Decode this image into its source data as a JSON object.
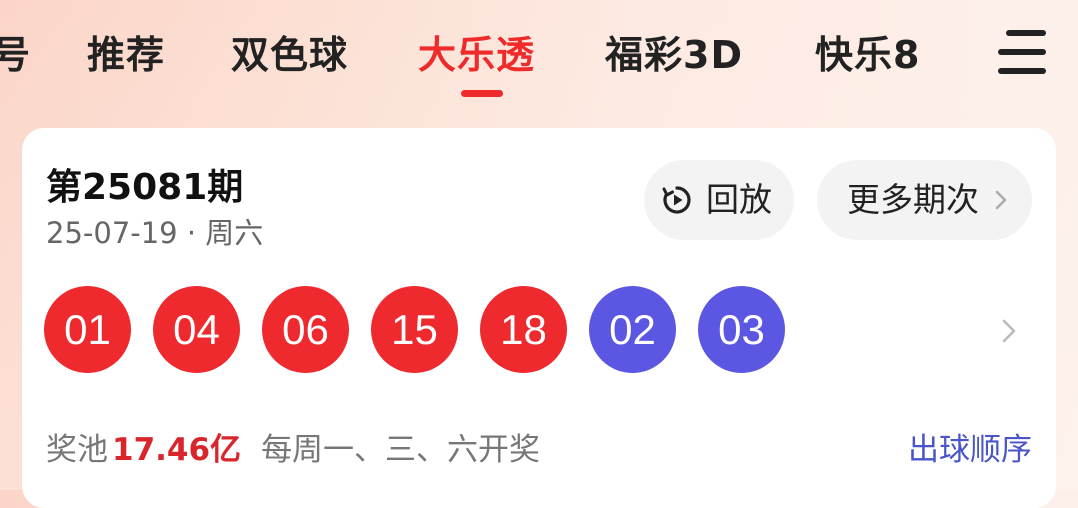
{
  "tabs": [
    {
      "label": "号",
      "active": false
    },
    {
      "label": "推荐",
      "active": false
    },
    {
      "label": "双色球",
      "active": false
    },
    {
      "label": "大乐透",
      "active": true
    },
    {
      "label": "福彩3D",
      "active": false
    },
    {
      "label": "快乐8",
      "active": false
    }
  ],
  "menu": {
    "icon": "hamburger-menu-icon"
  },
  "draw": {
    "title": "第25081期",
    "date": "25-07-19 · 周六",
    "replay_label": "回放",
    "replay_icon": "replay-play-icon",
    "more_label": "更多期次",
    "front_balls": [
      "01",
      "04",
      "06",
      "15",
      "18"
    ],
    "back_balls": [
      "02",
      "03"
    ],
    "pool_label": "奖池",
    "pool_amount": "17.46亿",
    "schedule": "每周一、三、六开奖",
    "order_link": "出球顺序"
  },
  "colors": {
    "accent_red": "#ee2a2a",
    "red_ball": "#ee2a2e",
    "blue_ball": "#5b57e3",
    "link_blue": "#4a56c8"
  }
}
